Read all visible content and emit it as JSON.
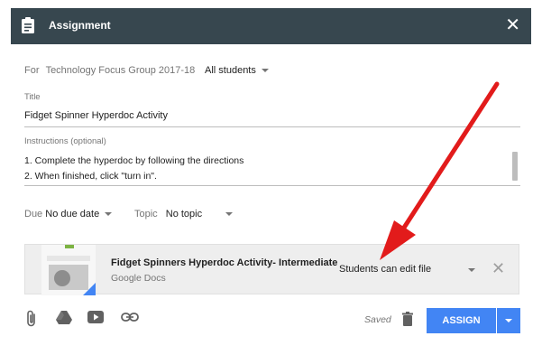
{
  "header": {
    "title": "Assignment",
    "close_glyph": "✕",
    "icon": "assignment-clipboard-icon"
  },
  "audience": {
    "for_label": "For",
    "class_name": "Technology Focus Group 2017-18",
    "students": "All students"
  },
  "title_field": {
    "label": "Title",
    "value": "Fidget Spinner Hyperdoc Activity"
  },
  "instructions_field": {
    "label": "Instructions (optional)",
    "lines": [
      "1. Complete the hyperdoc by following the directions",
      "2. When finished, click \"turn in\"."
    ]
  },
  "due": {
    "label": "Due",
    "value": "No due date"
  },
  "topic": {
    "label": "Topic",
    "value": "No topic"
  },
  "attachment": {
    "title": "Fidget Spinners Hyperdoc Activity- Intermediate",
    "type": "Google Docs",
    "permission": "Students can edit file",
    "close_glyph": "✕"
  },
  "toolbar": {
    "saved": "Saved",
    "assign_label": "ASSIGN",
    "icons": [
      "attach-file-icon",
      "google-drive-icon",
      "youtube-icon",
      "link-icon",
      "trash-icon"
    ]
  },
  "colors": {
    "header_bg": "#37474f",
    "accent": "#4285f4",
    "annotation_arrow": "#e21b1b"
  }
}
